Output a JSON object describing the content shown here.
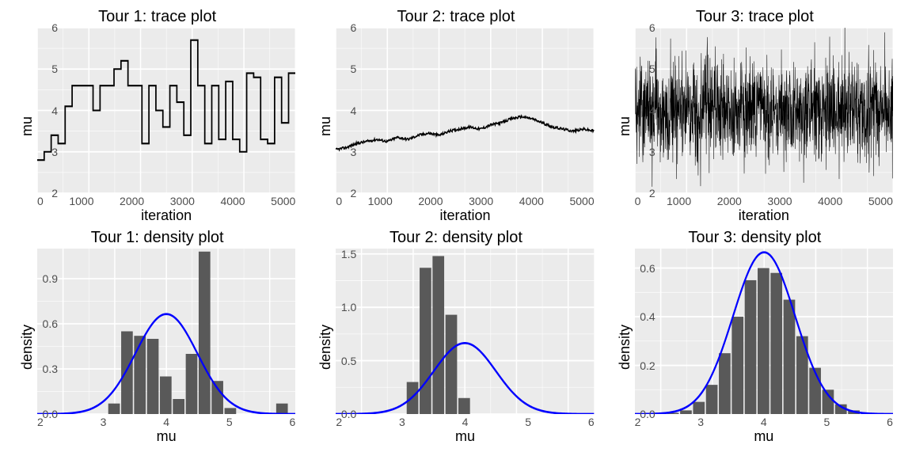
{
  "chart_data": [
    {
      "id": "trace1",
      "type": "line",
      "title": "Tour 1: trace plot",
      "xlabel": "iteration",
      "ylabel": "mu",
      "xlim": [
        0,
        5000
      ],
      "ylim": [
        2,
        6
      ],
      "xticks": [
        0,
        1000,
        2000,
        3000,
        4000,
        5000
      ],
      "yticks": [
        2,
        3,
        4,
        5,
        6
      ],
      "style": "step-blocky",
      "series": [
        {
          "name": "mu",
          "note": "blocky MCMC trace with long flat segments, approx values",
          "x": "0..5000",
          "values_sample": [
            2.8,
            3.0,
            3.4,
            3.2,
            4.1,
            4.6,
            4.6,
            4.6,
            4.0,
            4.6,
            4.6,
            5.0,
            5.2,
            4.6,
            4.6,
            3.2,
            4.6,
            4.0,
            3.6,
            4.6,
            4.2,
            3.4,
            5.7,
            4.6,
            3.2,
            4.6,
            3.3,
            4.7,
            3.3,
            3.0,
            4.9,
            4.8,
            3.3,
            3.2,
            4.8,
            3.7,
            4.9
          ]
        }
      ]
    },
    {
      "id": "trace2",
      "type": "line",
      "title": "Tour 2: trace plot",
      "xlabel": "iteration",
      "ylabel": "mu",
      "xlim": [
        0,
        5000
      ],
      "ylim": [
        2,
        6
      ],
      "xticks": [
        0,
        1000,
        2000,
        3000,
        4000,
        5000
      ],
      "yticks": [
        2,
        3,
        4,
        5,
        6
      ],
      "style": "slow-drift",
      "series": [
        {
          "name": "mu",
          "note": "slowly-varying autocorrelated trace around 3.3–3.8",
          "x": "0..5000",
          "values_sample": [
            3.05,
            3.1,
            3.2,
            3.25,
            3.3,
            3.25,
            3.35,
            3.3,
            3.4,
            3.45,
            3.4,
            3.5,
            3.55,
            3.6,
            3.55,
            3.65,
            3.7,
            3.8,
            3.85,
            3.8,
            3.7,
            3.6,
            3.55,
            3.5,
            3.55,
            3.5
          ]
        }
      ]
    },
    {
      "id": "trace3",
      "type": "line",
      "title": "Tour 3: trace plot",
      "xlabel": "iteration",
      "ylabel": "mu",
      "xlim": [
        0,
        5000
      ],
      "ylim": [
        2,
        6
      ],
      "xticks": [
        0,
        1000,
        2000,
        3000,
        4000,
        5000
      ],
      "yticks": [
        2,
        3,
        4,
        5,
        6
      ],
      "style": "fast-noise",
      "series": [
        {
          "name": "mu",
          "note": "well-mixed noisy trace, mean≈4, sd≈0.6, range≈2.5–6.2",
          "x": "0..5000",
          "mean": 4.0,
          "sd": 0.6,
          "n": 5000
        }
      ]
    },
    {
      "id": "dens1",
      "type": "bar",
      "title": "Tour 1: density plot",
      "xlabel": "mu",
      "ylabel": "density",
      "xlim": [
        1.5,
        6.5
      ],
      "ylim": [
        0,
        1.1
      ],
      "xticks": [
        2,
        3,
        4,
        5,
        6
      ],
      "yticks": [
        0.0,
        0.3,
        0.6,
        0.9
      ],
      "categories": [
        3.0,
        3.25,
        3.5,
        3.75,
        4.0,
        4.25,
        4.5,
        4.75,
        5.0,
        5.25,
        5.5,
        5.75,
        6.0,
        6.25
      ],
      "values": [
        0.07,
        0.55,
        0.52,
        0.5,
        0.25,
        0.1,
        0.4,
        1.08,
        0.22,
        0.04,
        0.0,
        0.0,
        0.0,
        0.07
      ],
      "overlay_curve": {
        "type": "normal",
        "mean": 4.0,
        "sd": 0.6,
        "peak": 0.665
      }
    },
    {
      "id": "dens2",
      "type": "bar",
      "title": "Tour 2: density plot",
      "xlabel": "mu",
      "ylabel": "density",
      "xlim": [
        1.5,
        6.5
      ],
      "ylim": [
        0,
        1.55
      ],
      "xticks": [
        2,
        3,
        4,
        5,
        6
      ],
      "yticks": [
        0.0,
        0.5,
        1.0,
        1.5
      ],
      "categories": [
        3.0,
        3.25,
        3.5,
        3.75,
        4.0
      ],
      "values": [
        0.3,
        1.37,
        1.48,
        0.93,
        0.15
      ],
      "overlay_curve": {
        "type": "normal",
        "mean": 4.0,
        "sd": 0.6,
        "peak": 0.665
      }
    },
    {
      "id": "dens3",
      "type": "bar",
      "title": "Tour 3: density plot",
      "xlabel": "mu",
      "ylabel": "density",
      "xlim": [
        1.5,
        6.5
      ],
      "ylim": [
        0,
        0.68
      ],
      "xticks": [
        2,
        3,
        4,
        5,
        6
      ],
      "yticks": [
        0.0,
        0.2,
        0.4,
        0.6
      ],
      "categories": [
        2.25,
        2.5,
        2.75,
        3.0,
        3.25,
        3.5,
        3.75,
        4.0,
        4.25,
        4.5,
        4.75,
        5.0,
        5.25,
        5.5,
        5.75,
        6.0
      ],
      "values": [
        0.005,
        0.015,
        0.05,
        0.12,
        0.25,
        0.4,
        0.55,
        0.6,
        0.58,
        0.47,
        0.32,
        0.19,
        0.1,
        0.04,
        0.015,
        0.005
      ],
      "overlay_curve": {
        "type": "normal",
        "mean": 4.0,
        "sd": 0.6,
        "peak": 0.665
      }
    }
  ]
}
